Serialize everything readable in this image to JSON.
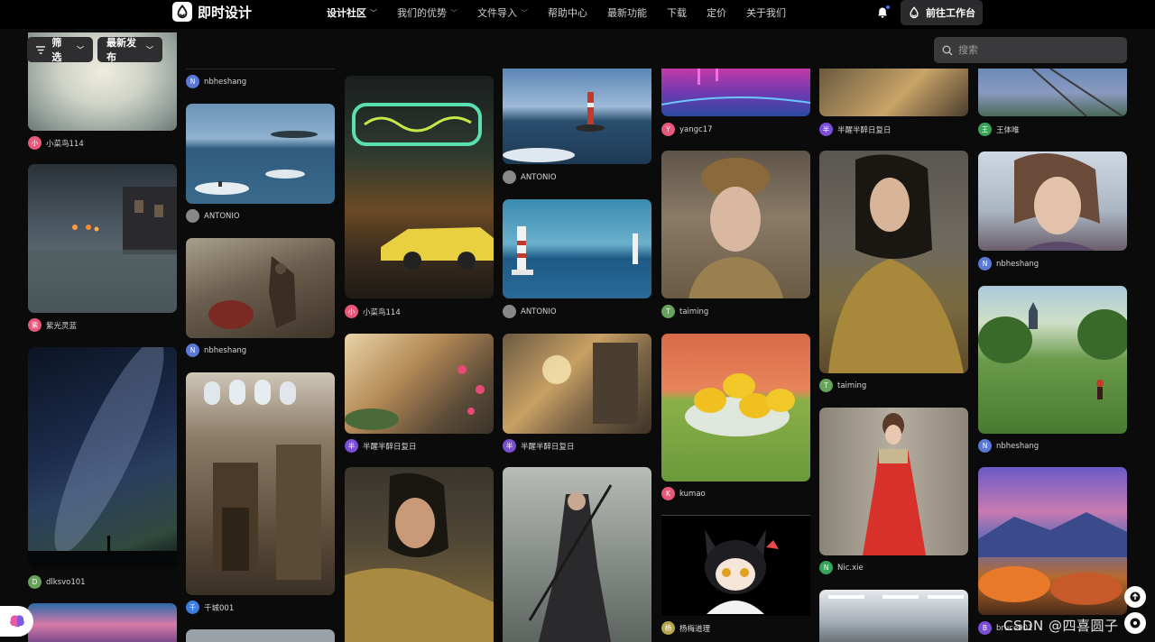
{
  "brand": {
    "name": "即时设计"
  },
  "nav": [
    {
      "label": "设计社区",
      "has_dropdown": true,
      "active": true
    },
    {
      "label": "我们的优势",
      "has_dropdown": true
    },
    {
      "label": "文件导入",
      "has_dropdown": true
    },
    {
      "label": "帮助中心",
      "has_dropdown": false
    },
    {
      "label": "最新功能",
      "has_dropdown": false
    },
    {
      "label": "下载",
      "has_dropdown": false
    },
    {
      "label": "定价",
      "has_dropdown": false
    },
    {
      "label": "关于我们",
      "has_dropdown": false
    }
  ],
  "header": {
    "workbench_label": "前往工作台",
    "notification_icon": "bell-icon",
    "accent": "#3d7bff"
  },
  "toolbar": {
    "filter_label": "筛选",
    "sort_label": "最新发布"
  },
  "search": {
    "placeholder": "搜索"
  },
  "authors": {
    "a1": {
      "name": "小菜鸟114",
      "initial": "小",
      "color": "#e8587a"
    },
    "a2": {
      "name": "紫光灵蓝",
      "initial": "紫",
      "color": "#e8587a"
    },
    "a3": {
      "name": "dlksvo101",
      "initial": "D",
      "color": "#67a35a"
    },
    "a4": {
      "name": "nbheshang",
      "initial": "N",
      "color": "#5a79d6"
    },
    "a5": {
      "name": "ANTONIO",
      "initial": "",
      "color": "#888888"
    },
    "a6": {
      "name": "nbheshang",
      "initial": "N",
      "color": "#5a79d6"
    },
    "a7": {
      "name": "千城001",
      "initial": "千",
      "color": "#3c7be0"
    },
    "a8": {
      "name": "小菜鸟114",
      "initial": "小",
      "color": "#e8587a"
    },
    "a9": {
      "name": "半醒半醉日复日",
      "initial": "半",
      "color": "#7a4fd6"
    },
    "a10": {
      "name": "ANTONIO",
      "initial": "",
      "color": "#888888"
    },
    "a11": {
      "name": "ANTONIO",
      "initial": "",
      "color": "#888888"
    },
    "a12": {
      "name": "半醒半醉日复日",
      "initial": "半",
      "color": "#7a4fd6"
    },
    "a13": {
      "name": "yangc17",
      "initial": "Y",
      "color": "#e8587a"
    },
    "a14": {
      "name": "taiming",
      "initial": "T",
      "color": "#67a35a"
    },
    "a15": {
      "name": "kumao",
      "initial": "K",
      "color": "#e8587a"
    },
    "a16": {
      "name": "杨梅道理",
      "initial": "杨",
      "color": "#b8a54a"
    },
    "a17": {
      "name": "半醒半醉日复日",
      "initial": "半",
      "color": "#7a4fd6"
    },
    "a18": {
      "name": "taiming",
      "initial": "T",
      "color": "#67a35a"
    },
    "a19": {
      "name": "Nic.xie",
      "initial": "N",
      "color": "#3aa35a"
    },
    "a20": {
      "name": "王体唯",
      "initial": "王",
      "color": "#3aa35a"
    },
    "a21": {
      "name": "nbheshang",
      "initial": "N",
      "color": "#5a79d6"
    },
    "a22": {
      "name": "nbheshang",
      "initial": "N",
      "color": "#5a79d6"
    },
    "a23": {
      "name": "bruce001",
      "initial": "B",
      "color": "#7a4fd6"
    }
  },
  "watermark": "CSDN @四喜圆子"
}
